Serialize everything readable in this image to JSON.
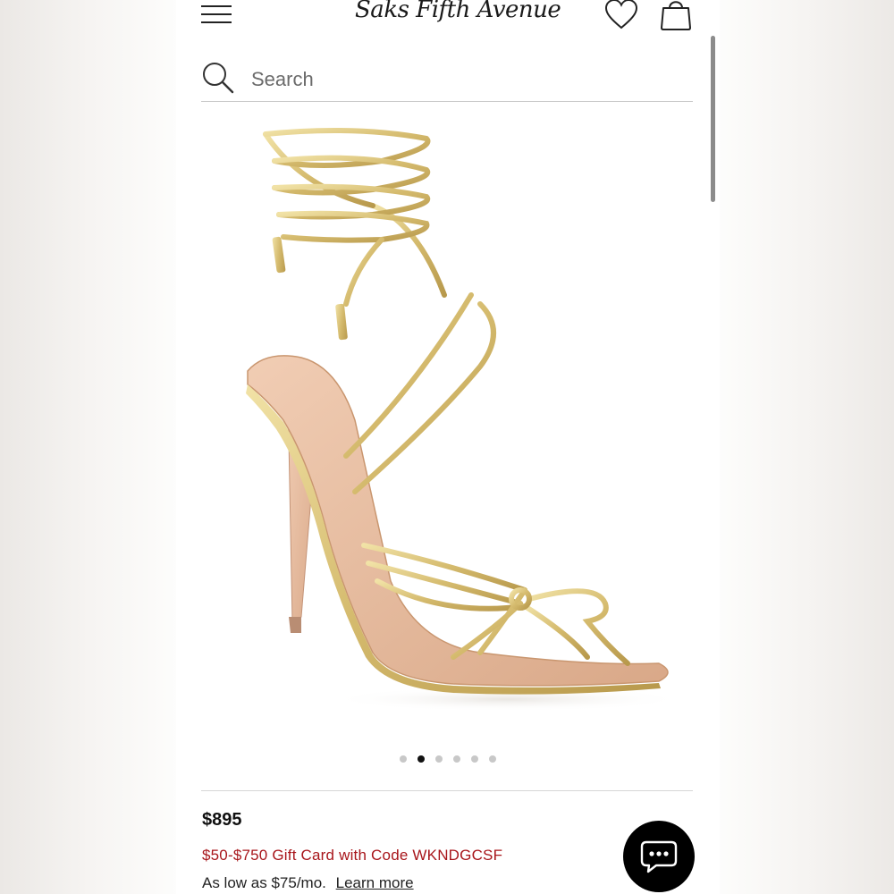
{
  "header": {
    "logo_text": "Saks Fifth Avenue",
    "menu_icon": "hamburger-menu-icon",
    "wishlist_icon": "heart-icon",
    "bag_icon": "shopping-bag-icon"
  },
  "search": {
    "placeholder": "Search",
    "value": "",
    "icon": "search-icon"
  },
  "product": {
    "image_icon": "gold-lace-up-sandal-image",
    "carousel": {
      "total": 6,
      "active_index": 1
    },
    "price": "$895",
    "promo": "$50-$750 Gift Card with Code WKNDGCSF",
    "financing_text": "As low as $75/mo.",
    "learn_more_label": "Learn more"
  },
  "chat": {
    "icon": "chat-bubble-icon"
  },
  "colors": {
    "promo_red": "#a8161b",
    "gold": "#d9c27a",
    "sole_nude": "#e6b89c"
  }
}
